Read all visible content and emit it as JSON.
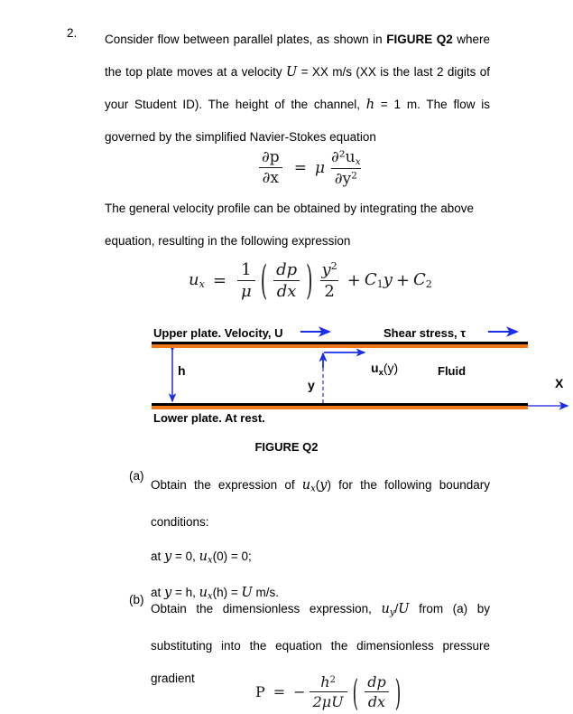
{
  "question": {
    "number": "2.",
    "intro_lines": [
      {
        "segments": [
          {
            "t": "Consider flow between parallel plates, as shown in ",
            "s": "plain"
          },
          {
            "t": "FIGURE Q2",
            "s": "bold"
          },
          {
            "t": " where",
            "s": "plain"
          }
        ]
      },
      {
        "segments": [
          {
            "t": "the top plate moves at a velocity ",
            "s": "plain"
          },
          {
            "t": "U",
            "s": "mathit"
          },
          {
            "t": " = XX m/s (XX is the last 2 digits of",
            "s": "plain"
          }
        ]
      },
      {
        "segments": [
          {
            "t": "your Student ID). The height of the channel, ",
            "s": "plain"
          },
          {
            "t": "h",
            "s": "mathit"
          },
          {
            "t": " = 1 m.   The flow is",
            "s": "plain"
          }
        ]
      },
      {
        "segments": [
          {
            "t": "governed by the simplified Navier-Stokes equation",
            "s": "plain"
          }
        ]
      }
    ],
    "mid_lines": [
      {
        "segments": [
          {
            "t": "The general velocity profile can be obtained by integrating the above",
            "s": "plain"
          }
        ]
      },
      {
        "segments": [
          {
            "t": "equation, resulting in the following expression",
            "s": "plain"
          }
        ]
      }
    ]
  },
  "equations": {
    "navier_stokes": {
      "lhs_num": "∂p",
      "lhs_den": "∂x",
      "equals": "=",
      "mu": "μ",
      "rhs_num": "∂²u",
      "rhs_num_sub": "x",
      "rhs_den": "∂y",
      "rhs_den_sup": "2",
      "plain": "∂p/∂x = μ ∂²u_x/∂y²"
    },
    "velocity_profile": {
      "lhs": "u",
      "lhs_sub": "x",
      "equals": "=",
      "f1_num": "1",
      "f1_den": "μ",
      "f2_num": "dp",
      "f2_den": "dx",
      "f3_num": "y",
      "f3_num_sup": "2",
      "f3_den": "2",
      "plus1": "+",
      "c1": "C",
      "c1_sub": "1",
      "c1_var": "y",
      "plus2": "+",
      "c2": "C",
      "c2_sub": "2",
      "plain": "u_x = (1/μ)(dp/dx)(y²/2) + C₁y + C₂"
    },
    "pressure_gradient": {
      "lhs": "P",
      "equals": "=",
      "minus": "−",
      "num": "h",
      "num_sup": "2",
      "den": "2μU",
      "p_num": "dp",
      "p_den": "dx",
      "plain": "P = − h²/(2μU) (dp/dx)"
    }
  },
  "figure": {
    "caption": "FIGURE Q2",
    "upper_plate_label": "Upper plate. Velocity, U",
    "shear_stress_label": "Shear stress, τ",
    "lower_plate_label": "Lower plate. At rest.",
    "fluid_label": "Fluid",
    "h_label": "h",
    "y_label": "y",
    "x_label": "X",
    "ux_label_base": "u",
    "ux_label_sub": "x",
    "ux_label_arg": "(y)",
    "colors": {
      "plate_black": "#000000",
      "plate_orange": "#f07818",
      "arrow_blue": "#1a2ee8"
    }
  },
  "parts": {
    "a": {
      "marker": "(a)",
      "lines": [
        {
          "segments": [
            {
              "t": "Obtain  the  expression  of  ",
              "s": "plain"
            },
            {
              "t": "u",
              "s": "mathit"
            },
            {
              "t": "x",
              "s": "mathsub"
            },
            {
              "t": "(",
              "s": "plain"
            },
            {
              "t": "y",
              "s": "mathit"
            },
            {
              "t": ")",
              "s": "plain"
            },
            {
              "t": "  for  the  following  boundary",
              "s": "plain"
            }
          ]
        },
        {
          "segments": [
            {
              "t": "conditions:",
              "s": "plain"
            }
          ]
        }
      ],
      "boundary_conditions": [
        {
          "segments": [
            {
              "t": "at ",
              "s": "plain"
            },
            {
              "t": "y",
              "s": "mathit"
            },
            {
              "t": " = 0, ",
              "s": "plain"
            },
            {
              "t": "u",
              "s": "mathit"
            },
            {
              "t": "x",
              "s": "mathsub"
            },
            {
              "t": "(0)",
              "s": "plain"
            },
            {
              "t": "  = 0;",
              "s": "plain"
            }
          ]
        },
        {
          "segments": [
            {
              "t": "at ",
              "s": "plain"
            },
            {
              "t": "y",
              "s": "mathit"
            },
            {
              "t": " = h, ",
              "s": "plain"
            },
            {
              "t": "u",
              "s": "mathit"
            },
            {
              "t": "x",
              "s": "mathsub"
            },
            {
              "t": "(h) = ",
              "s": "plain"
            },
            {
              "t": "U",
              "s": "mathit"
            },
            {
              "t": " m/s.",
              "s": "plain"
            }
          ]
        }
      ]
    },
    "b": {
      "marker": "(b)",
      "lines": [
        {
          "segments": [
            {
              "t": "Obtain   the   dimensionless   expression,   ",
              "s": "plain"
            },
            {
              "t": "u",
              "s": "mathit"
            },
            {
              "t": "y",
              "s": "mathsub"
            },
            {
              "t": "/",
              "s": "plain"
            },
            {
              "t": "U",
              "s": "mathit"
            },
            {
              "t": "   from   (a)   by",
              "s": "plain"
            }
          ]
        },
        {
          "segments": [
            {
              "t": "substituting   into   the   equation   the   dimensionless   pressure",
              "s": "plain"
            }
          ]
        },
        {
          "segments": [
            {
              "t": "gradient",
              "s": "plain"
            }
          ]
        }
      ]
    }
  }
}
